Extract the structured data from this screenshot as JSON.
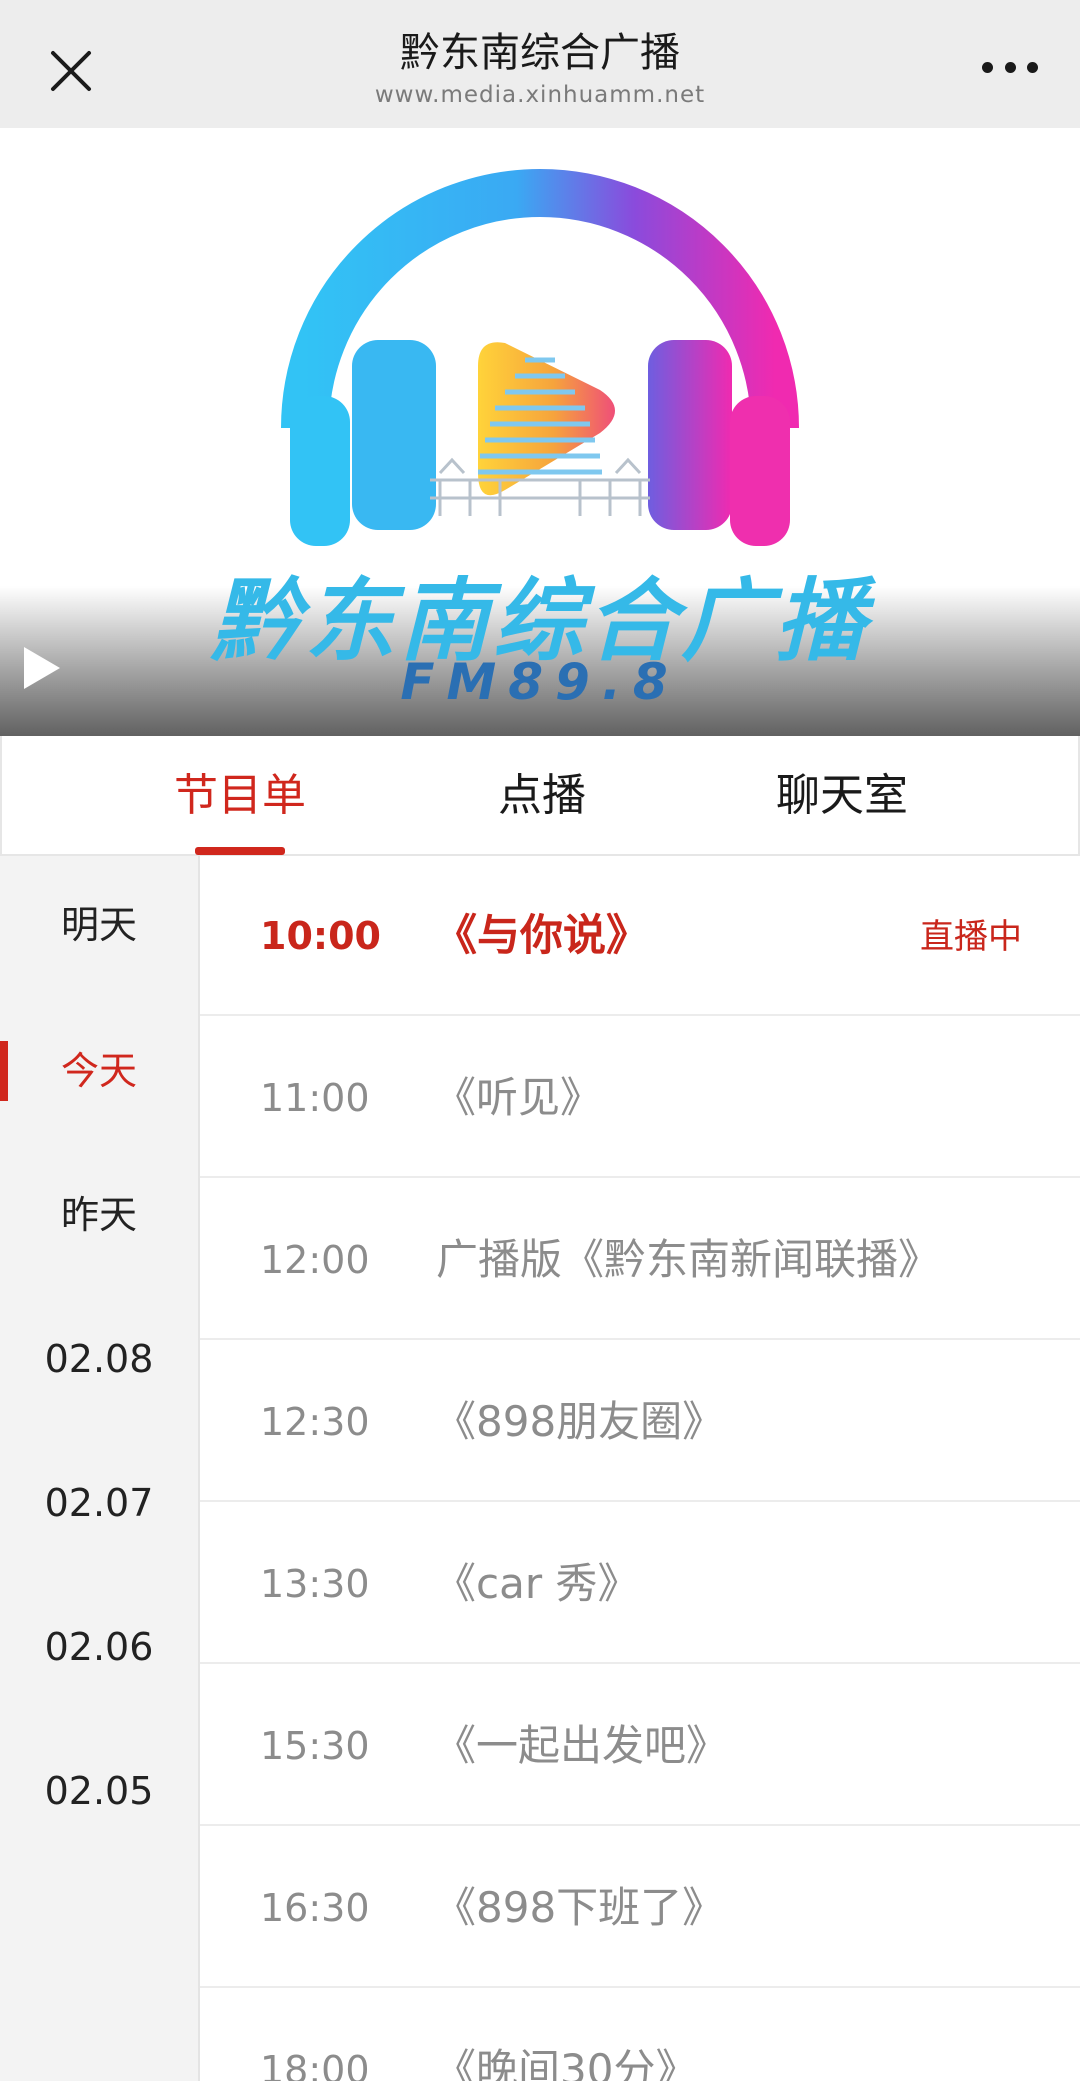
{
  "navbar": {
    "title": "黔东南综合广播",
    "url": "www.media.xinhuamm.net",
    "close_icon": "close-icon",
    "more_icon": "more-dots-icon"
  },
  "banner": {
    "station_name": "黔东南综合广播",
    "frequency": "FM89.8",
    "play_icon": "play-icon"
  },
  "tabs": [
    {
      "label": "节目单",
      "active": true
    },
    {
      "label": "点播",
      "active": false
    },
    {
      "label": "聊天室",
      "active": false
    }
  ],
  "days": [
    {
      "label": "明天",
      "active": false
    },
    {
      "label": "今天",
      "active": true
    },
    {
      "label": "昨天",
      "active": false
    },
    {
      "label": "02.08",
      "active": false
    },
    {
      "label": "02.07",
      "active": false
    },
    {
      "label": "02.06",
      "active": false
    },
    {
      "label": "02.05",
      "active": false
    }
  ],
  "schedule": [
    {
      "time": "10:00",
      "title": "《与你说》",
      "status": "直播中",
      "live": true
    },
    {
      "time": "11:00",
      "title": "《听见》",
      "status": "",
      "live": false
    },
    {
      "time": "12:00",
      "title": "广播版《黔东南新闻联播》",
      "status": "",
      "live": false
    },
    {
      "time": "12:30",
      "title": "《898朋友圈》",
      "status": "",
      "live": false
    },
    {
      "time": "13:30",
      "title": "《car 秀》",
      "status": "",
      "live": false
    },
    {
      "time": "15:30",
      "title": "《一起出发吧》",
      "status": "",
      "live": false
    },
    {
      "time": "16:30",
      "title": "《898下班了》",
      "status": "",
      "live": false
    },
    {
      "time": "18:00",
      "title": "《晚间30分》",
      "status": "",
      "live": false
    }
  ],
  "colors": {
    "accent": "#d0271d",
    "navbar_bg": "#ededed",
    "sidebar_bg": "#f3f3f3",
    "muted_text": "#8c8c8c"
  }
}
